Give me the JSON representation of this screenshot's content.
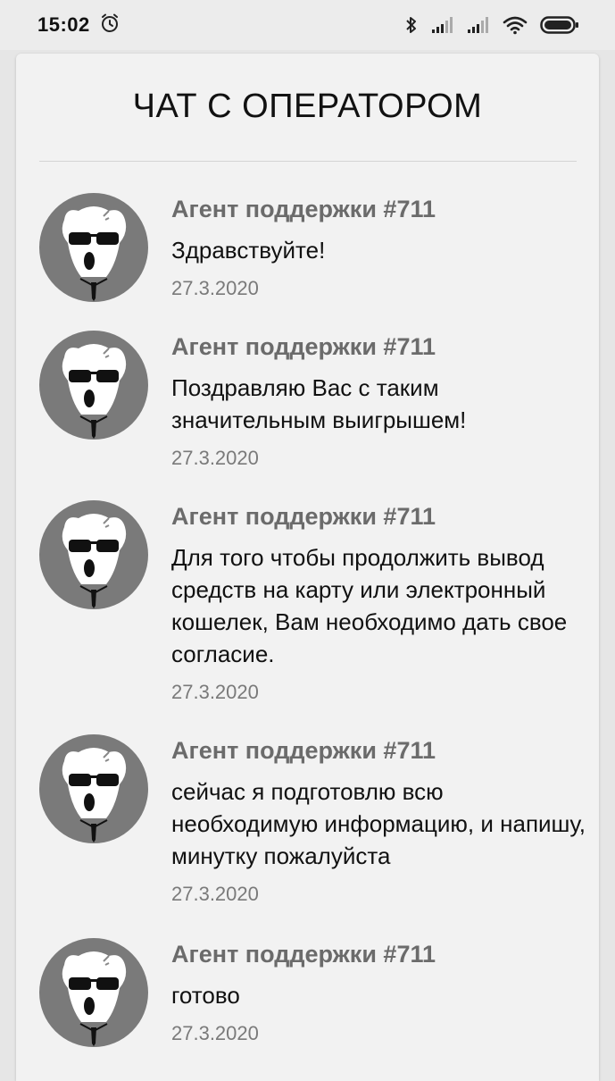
{
  "status_bar": {
    "time": "15:02",
    "icons": [
      "alarm-icon",
      "bluetooth-icon",
      "signal-icon",
      "signal-icon",
      "wifi-icon",
      "battery-icon"
    ]
  },
  "chat": {
    "title": "ЧАТ С ОПЕРАТОРОМ",
    "messages": [
      {
        "sender": "Агент поддержки #711",
        "text": "Здравствуйте!",
        "date": "27.3.2020"
      },
      {
        "sender": "Агент поддержки #711",
        "text": "Поздравляю Вас с таким значительным выигрышем!",
        "date": "27.3.2020"
      },
      {
        "sender": "Агент поддержки #711",
        "text": "Для того чтобы продолжить вывод средств на карту или электронный кошелек, Вам необходимо дать свое согласие.",
        "date": "27.3.2020"
      },
      {
        "sender": "Агент поддержки #711",
        "text": "сейчас я подготовлю всю необходимую информацию, и напишу, минутку пожалуйста",
        "date": "27.3.2020"
      },
      {
        "sender": "Агент поддержки #711",
        "text": "готово",
        "date": "27.3.2020"
      }
    ]
  }
}
